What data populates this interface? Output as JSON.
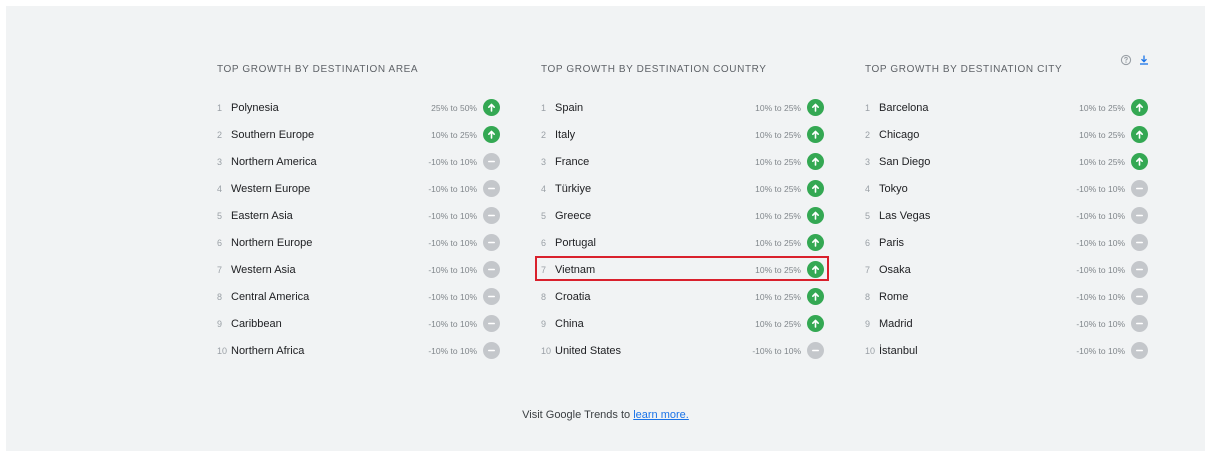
{
  "columns": [
    {
      "title": "TOP GROWTH BY DESTINATION AREA",
      "items": [
        {
          "rank": "1",
          "name": "Polynesia",
          "range": "25% to 50%",
          "trend": "up"
        },
        {
          "rank": "2",
          "name": "Southern Europe",
          "range": "10% to 25%",
          "trend": "up"
        },
        {
          "rank": "3",
          "name": "Northern America",
          "range": "-10% to 10%",
          "trend": "flat"
        },
        {
          "rank": "4",
          "name": "Western Europe",
          "range": "-10% to 10%",
          "trend": "flat"
        },
        {
          "rank": "5",
          "name": "Eastern Asia",
          "range": "-10% to 10%",
          "trend": "flat"
        },
        {
          "rank": "6",
          "name": "Northern Europe",
          "range": "-10% to 10%",
          "trend": "flat"
        },
        {
          "rank": "7",
          "name": "Western Asia",
          "range": "-10% to 10%",
          "trend": "flat"
        },
        {
          "rank": "8",
          "name": "Central America",
          "range": "-10% to 10%",
          "trend": "flat"
        },
        {
          "rank": "9",
          "name": "Caribbean",
          "range": "-10% to 10%",
          "trend": "flat"
        },
        {
          "rank": "10",
          "name": "Northern Africa",
          "range": "-10% to 10%",
          "trend": "flat"
        }
      ]
    },
    {
      "title": "TOP GROWTH BY DESTINATION COUNTRY",
      "items": [
        {
          "rank": "1",
          "name": "Spain",
          "range": "10% to 25%",
          "trend": "up"
        },
        {
          "rank": "2",
          "name": "Italy",
          "range": "10% to 25%",
          "trend": "up"
        },
        {
          "rank": "3",
          "name": "France",
          "range": "10% to 25%",
          "trend": "up"
        },
        {
          "rank": "4",
          "name": "Türkiye",
          "range": "10% to 25%",
          "trend": "up"
        },
        {
          "rank": "5",
          "name": "Greece",
          "range": "10% to 25%",
          "trend": "up"
        },
        {
          "rank": "6",
          "name": "Portugal",
          "range": "10% to 25%",
          "trend": "up"
        },
        {
          "rank": "7",
          "name": "Vietnam",
          "range": "10% to 25%",
          "trend": "up",
          "highlighted": true
        },
        {
          "rank": "8",
          "name": "Croatia",
          "range": "10% to 25%",
          "trend": "up"
        },
        {
          "rank": "9",
          "name": "China",
          "range": "10% to 25%",
          "trend": "up"
        },
        {
          "rank": "10",
          "name": "United States",
          "range": "-10% to 10%",
          "trend": "flat"
        }
      ]
    },
    {
      "title": "TOP GROWTH BY DESTINATION CITY",
      "items": [
        {
          "rank": "1",
          "name": "Barcelona",
          "range": "10% to 25%",
          "trend": "up"
        },
        {
          "rank": "2",
          "name": "Chicago",
          "range": "10% to 25%",
          "trend": "up"
        },
        {
          "rank": "3",
          "name": "San Diego",
          "range": "10% to 25%",
          "trend": "up"
        },
        {
          "rank": "4",
          "name": "Tokyo",
          "range": "-10% to 10%",
          "trend": "flat"
        },
        {
          "rank": "5",
          "name": "Las Vegas",
          "range": "-10% to 10%",
          "trend": "flat"
        },
        {
          "rank": "6",
          "name": "Paris",
          "range": "-10% to 10%",
          "trend": "flat"
        },
        {
          "rank": "7",
          "name": "Osaka",
          "range": "-10% to 10%",
          "trend": "flat"
        },
        {
          "rank": "8",
          "name": "Rome",
          "range": "-10% to 10%",
          "trend": "flat"
        },
        {
          "rank": "9",
          "name": "Madrid",
          "range": "-10% to 10%",
          "trend": "flat"
        },
        {
          "rank": "10",
          "name": "İstanbul",
          "range": "-10% to 10%",
          "trend": "flat"
        }
      ]
    }
  ],
  "footer": {
    "text": "Visit Google Trends to ",
    "link": "learn more."
  },
  "icons": {
    "help": "help-circle-icon",
    "download": "download-icon"
  },
  "colors": {
    "up": "#34a853",
    "flat": "#c4c7cb",
    "highlight": "#d9202c",
    "link": "#1a73e8"
  }
}
